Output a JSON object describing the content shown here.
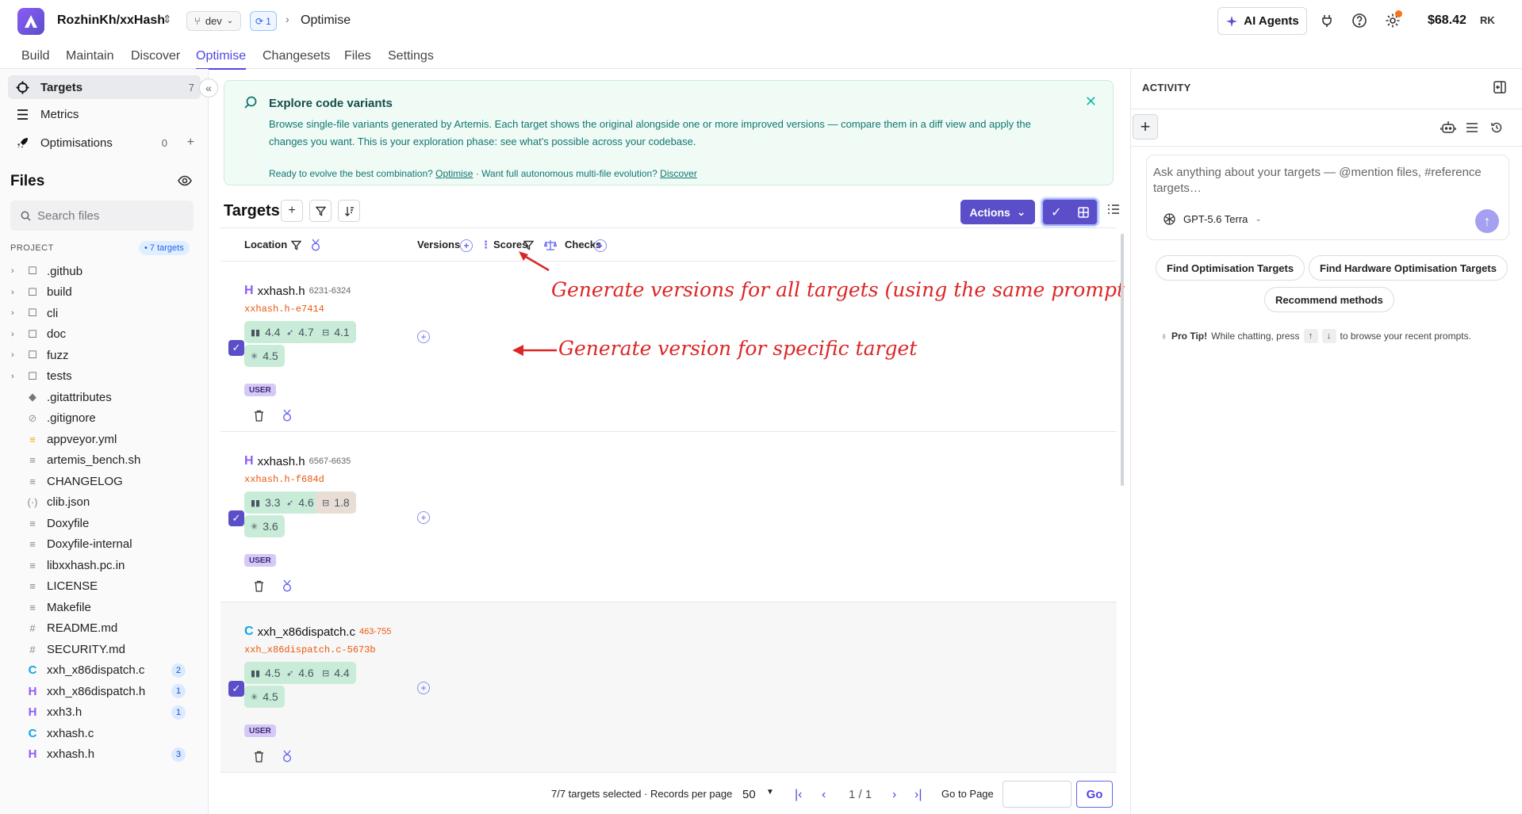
{
  "header": {
    "repo": "RozhinKh/xxHash",
    "branch": "dev",
    "sync_count": "1",
    "breadcrumb": "Optimise",
    "ai_agents_label": "AI Agents",
    "balance": "$68.42",
    "avatar": "RK"
  },
  "tabs": [
    "Build",
    "Maintain",
    "Discover",
    "Optimise",
    "Changesets",
    "Files",
    "Settings"
  ],
  "sidebar": {
    "items": [
      {
        "label": "Targets",
        "count": "7"
      },
      {
        "label": "Metrics",
        "count": ""
      },
      {
        "label": "Optimisations",
        "count": "0"
      }
    ],
    "files_title": "Files",
    "search_placeholder": "Search files",
    "project_label": "PROJECT",
    "targets_badge": "• 7 targets",
    "tree": [
      {
        "name": ".github",
        "type": "folder",
        "badge": ""
      },
      {
        "name": "build",
        "type": "folder",
        "badge": ""
      },
      {
        "name": "cli",
        "type": "folder",
        "badge": ""
      },
      {
        "name": "doc",
        "type": "folder",
        "badge": ""
      },
      {
        "name": "fuzz",
        "type": "folder",
        "badge": ""
      },
      {
        "name": "tests",
        "type": "folder",
        "badge": ""
      },
      {
        "name": ".gitattributes",
        "type": "git",
        "badge": ""
      },
      {
        "name": ".gitignore",
        "type": "ignore",
        "badge": ""
      },
      {
        "name": "appveyor.yml",
        "type": "yml",
        "badge": ""
      },
      {
        "name": "artemis_bench.sh",
        "type": "text",
        "badge": ""
      },
      {
        "name": "CHANGELOG",
        "type": "text",
        "badge": ""
      },
      {
        "name": "clib.json",
        "type": "json",
        "badge": ""
      },
      {
        "name": "Doxyfile",
        "type": "text",
        "badge": ""
      },
      {
        "name": "Doxyfile-internal",
        "type": "text",
        "badge": ""
      },
      {
        "name": "libxxhash.pc.in",
        "type": "text",
        "badge": ""
      },
      {
        "name": "LICENSE",
        "type": "text",
        "badge": ""
      },
      {
        "name": "Makefile",
        "type": "text",
        "badge": ""
      },
      {
        "name": "README.md",
        "type": "md",
        "badge": ""
      },
      {
        "name": "SECURITY.md",
        "type": "md",
        "badge": ""
      },
      {
        "name": "xxh_x86dispatch.c",
        "type": "c",
        "badge": "2"
      },
      {
        "name": "xxh_x86dispatch.h",
        "type": "h",
        "badge": "1"
      },
      {
        "name": "xxh3.h",
        "type": "h",
        "badge": "1"
      },
      {
        "name": "xxhash.c",
        "type": "c",
        "badge": ""
      },
      {
        "name": "xxhash.h",
        "type": "h",
        "badge": "3"
      }
    ]
  },
  "banner": {
    "title": "Explore code variants",
    "body": "Browse single-file variants generated by Artemis. Each target shows the original alongside one or more improved versions — compare them in a diff view and apply the changes you want. This is your exploration phase: see what's possible across your codebase.",
    "footer_pre": "Ready to evolve the best combination?",
    "footer_link1": "Optimise",
    "footer_mid": "· Want full autonomous multi-file evolution?",
    "footer_link2": "Discover"
  },
  "targets": {
    "title": "Targets",
    "actions_label": "Actions",
    "columns": [
      "Location",
      "Versions",
      "Scores",
      "Checks"
    ],
    "rows": [
      {
        "file": "xxhash.h",
        "type": "H",
        "range": "6231-6324",
        "hash": "xxhash.h-e7414",
        "scores": [
          "4.4",
          "4.7",
          "4.1",
          "4.5"
        ],
        "tag": "USER"
      },
      {
        "file": "xxhash.h",
        "type": "H",
        "range": "6567-6635",
        "hash": "xxhash.h-f684d",
        "scores": [
          "3.3",
          "4.6",
          "1.8",
          "3.6"
        ],
        "tag": "USER"
      },
      {
        "file": "xxh_x86dispatch.c",
        "type": "C",
        "range": "463-755",
        "hash": "xxh_x86dispatch.c-5673b",
        "scores": [
          "4.5",
          "4.6",
          "4.4",
          "4.5"
        ],
        "tag": "USER"
      }
    ]
  },
  "annotations": {
    "all": "Generate versions for all targets (using the same prompt and setting)",
    "one": "Generate version for specific target"
  },
  "pager": {
    "selected": "7/7 targets selected · Records per page",
    "per_page": "50",
    "page": "1 / 1",
    "goto": "Go to Page",
    "go": "Go"
  },
  "activity": {
    "title": "ACTIVITY",
    "placeholder": "Ask anything about your targets — @mention files, #reference targets…",
    "model": "GPT-5.6 Terra",
    "suggestions": [
      "Find Optimisation Targets",
      "Find Hardware Optimisation Targets",
      "Recommend methods"
    ],
    "tip_title": "Pro Tip!",
    "tip_pre": "While chatting, press",
    "tip_post": "to browse your recent prompts."
  },
  "colors": {
    "accent": "#5b4fc9",
    "score_bg": "#c9ecd8",
    "annotation": "#dc2626"
  }
}
